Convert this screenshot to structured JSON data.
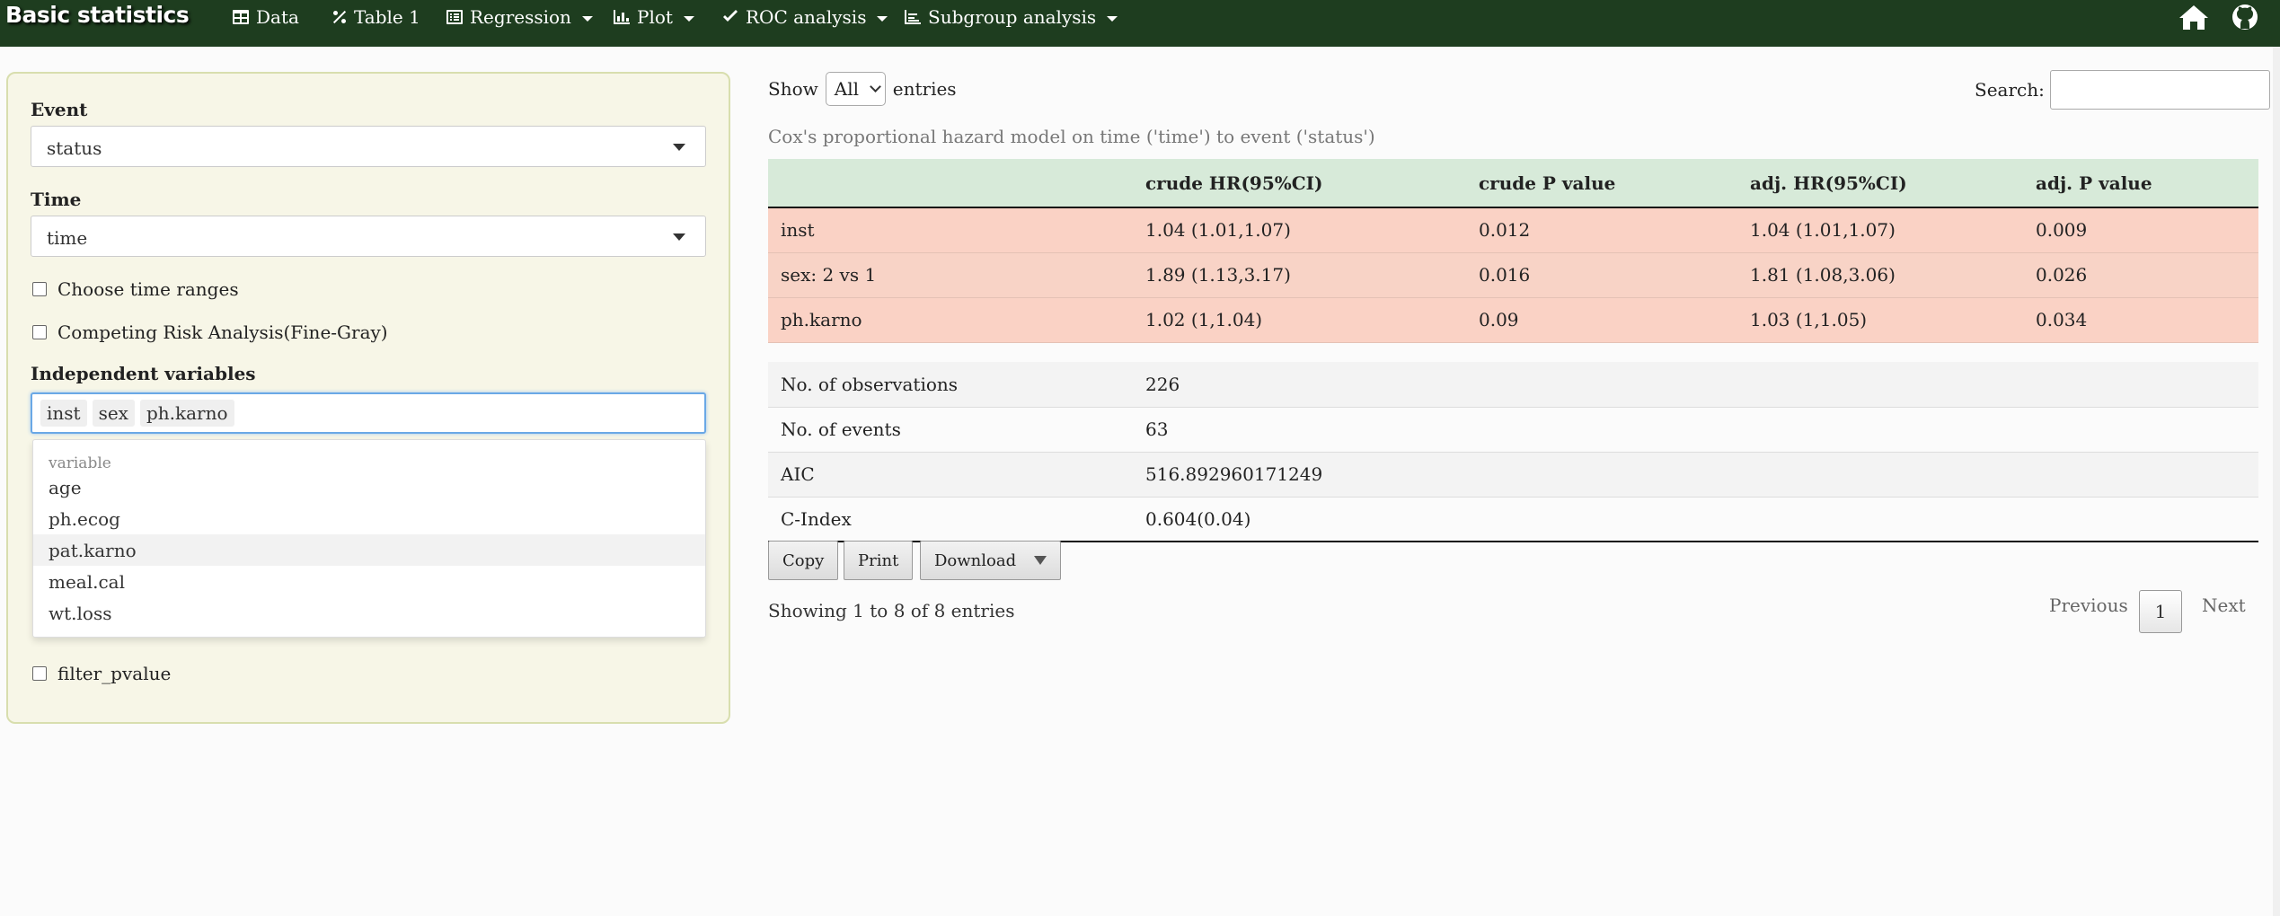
{
  "navbar": {
    "brand": "Basic statistics",
    "items": [
      {
        "label": "Data",
        "icon": "table-icon"
      },
      {
        "label": "Table 1",
        "icon": "percent-icon"
      },
      {
        "label": "Regression",
        "icon": "list-alt-icon"
      },
      {
        "label": "Plot",
        "icon": "bar-chart-icon"
      },
      {
        "label": "ROC analysis",
        "icon": "check-icon"
      },
      {
        "label": "Subgroup analysis",
        "icon": "line-chart-icon"
      }
    ],
    "right_icons": [
      "home-icon",
      "github-icon"
    ]
  },
  "sidebar": {
    "event_label": "Event",
    "event_value": "status",
    "time_label": "Time",
    "time_value": "time",
    "choose_time_ranges": "Choose time ranges",
    "competing_risk": "Competing Risk Analysis(Fine-Gray)",
    "indep_label": "Independent variables",
    "selected_vars": [
      "inst",
      "sex",
      "ph.karno"
    ],
    "dropdown_group": "variable",
    "dropdown_options": [
      "age",
      "ph.ecog",
      "pat.karno",
      "meal.cal",
      "wt.loss"
    ],
    "dropdown_highlighted": "pat.karno",
    "filter_pvalue": "filter_pvalue"
  },
  "main": {
    "show_label": "Show",
    "length_value": "All",
    "entries_label": "entries",
    "search_label": "Search:",
    "caption": "Cox's proportional hazard model on time ('time') to event ('status')",
    "columns": [
      "",
      "crude HR(95%CI)",
      "crude P value",
      "adj. HR(95%CI)",
      "adj. P value"
    ],
    "rows": [
      [
        "inst",
        "1.04 (1.01,1.07)",
        "0.012",
        "1.04 (1.01,1.07)",
        "0.009"
      ],
      [
        "sex: 2 vs 1",
        "1.89 (1.13,3.17)",
        "0.016",
        "1.81 (1.08,3.06)",
        "0.026"
      ],
      [
        "ph.karno",
        "1.02 (1,1.04)",
        "0.09",
        "1.03 (1,1.05)",
        "0.034"
      ]
    ],
    "stats": [
      [
        "No. of observations",
        "226"
      ],
      [
        "No. of events",
        "63"
      ],
      [
        "AIC",
        "516.892960171249"
      ],
      [
        "C-Index",
        "0.604(0.04)"
      ]
    ],
    "buttons": {
      "copy": "Copy",
      "print": "Print",
      "download": "Download"
    },
    "info": "Showing 1 to 8 of 8 entries",
    "pager": {
      "previous": "Previous",
      "page": "1",
      "next": "Next"
    }
  },
  "colors": {
    "navbar": "#1e3d1f",
    "sidebar_bg": "#f7f6e7",
    "header_bg": "#d7ead9",
    "highlight_row": "#f8d3c6"
  }
}
